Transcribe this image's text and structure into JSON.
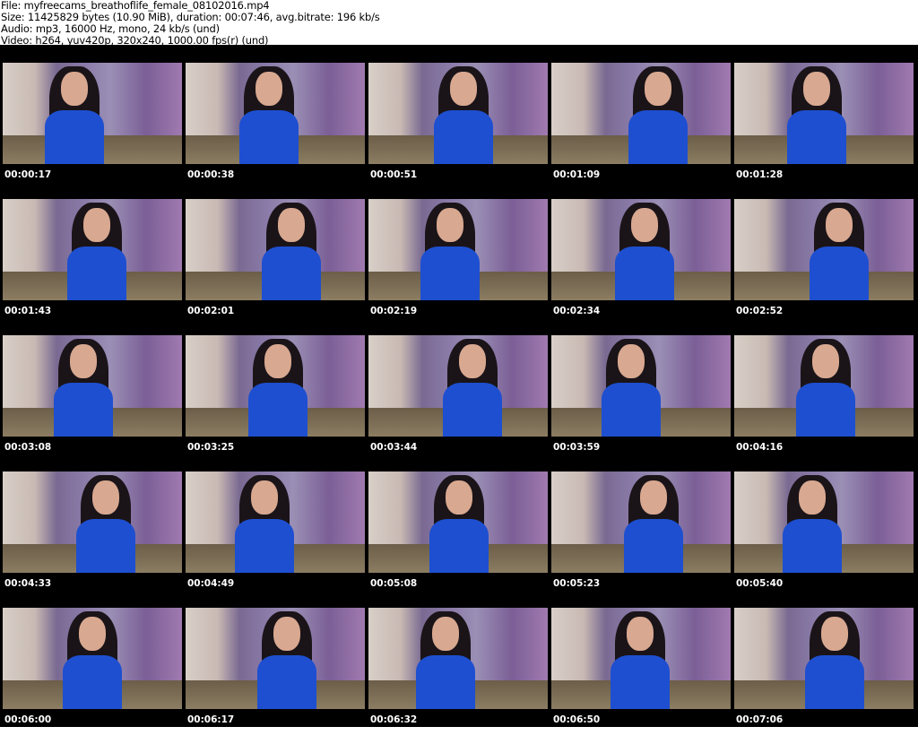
{
  "header": {
    "file": "File: myfreecams_breathoflife_female_08102016.mp4",
    "size": "Size: 11425829 bytes (10.90 MiB), duration: 00:07:46, avg.bitrate: 196 kb/s",
    "audio": "Audio: mp3, 16000 Hz, mono, 24 kb/s (und)",
    "video": "Video: h264, yuv420p, 320x240, 1000.00 fps(r) (und)"
  },
  "thumbnails": [
    "00:00:17",
    "00:00:38",
    "00:00:51",
    "00:01:09",
    "00:01:28",
    "00:01:43",
    "00:02:01",
    "00:02:19",
    "00:02:34",
    "00:02:52",
    "00:03:08",
    "00:03:25",
    "00:03:44",
    "00:03:59",
    "00:04:16",
    "00:04:33",
    "00:04:49",
    "00:05:08",
    "00:05:23",
    "00:05:40",
    "00:06:00",
    "00:06:17",
    "00:06:32",
    "00:06:50",
    "00:07:06"
  ]
}
